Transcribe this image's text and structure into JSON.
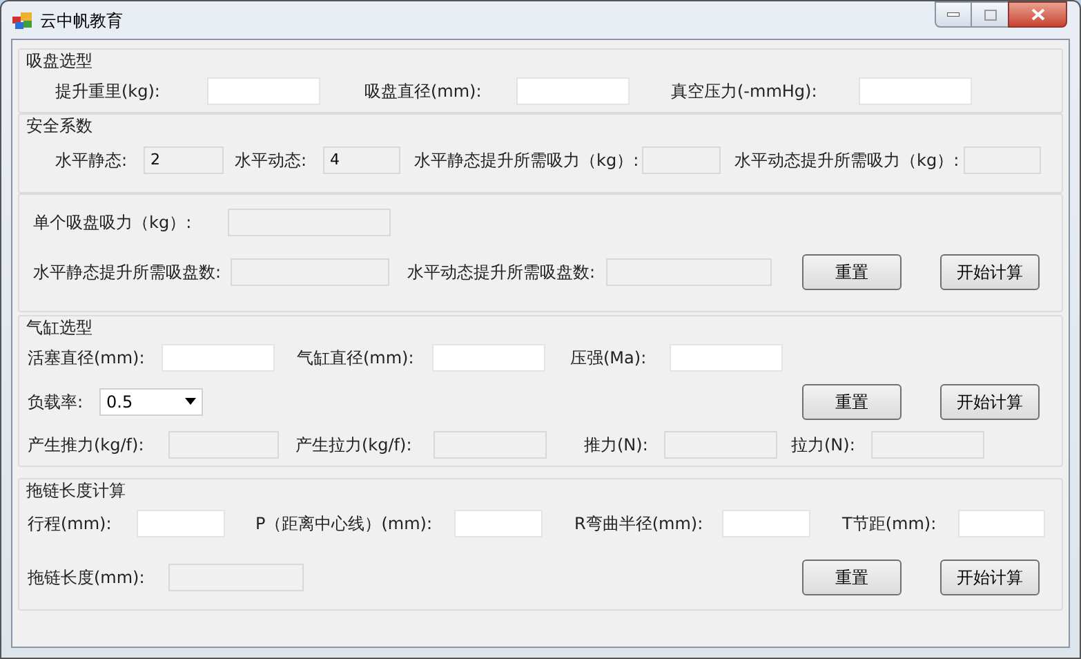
{
  "window": {
    "title": "云中帆教育"
  },
  "sections": [
    {
      "title": "吸盘选型",
      "rows": [
        [
          {
            "kind": "input",
            "label": "提升重里(kg):"
          },
          {
            "kind": "input",
            "label": "吸盘直径(mm):"
          },
          {
            "kind": "input",
            "label": "真空压力(-mmHg):"
          }
        ]
      ]
    },
    {
      "title": "安全系数",
      "rows": [
        [
          {
            "kind": "readonly",
            "label": "水平静态:",
            "value": "2"
          },
          {
            "kind": "readonly",
            "label": "水平动态:",
            "value": "4"
          },
          {
            "kind": "readonly",
            "label": "水平静态提升所需吸力（kg）:"
          },
          {
            "kind": "readonly",
            "label": "水平动态提升所需吸力（kg）:"
          }
        ]
      ]
    },
    {
      "rows": [
        [
          {
            "kind": "readonly",
            "label": "单个吸盘吸力（kg）:"
          }
        ],
        [
          {
            "kind": "readonly",
            "label": "水平静态提升所需吸盘数:"
          },
          {
            "kind": "readonly",
            "label": "水平动态提升所需吸盘数:"
          }
        ]
      ],
      "buttons": [
        "重置",
        "开始计算"
      ]
    },
    {
      "title": "气缸选型",
      "rows": [
        [
          {
            "kind": "input",
            "label": "活塞直径(mm):"
          },
          {
            "kind": "input",
            "label": "气缸直径(mm):"
          },
          {
            "kind": "input",
            "label": "压强(Ma):"
          }
        ],
        [
          {
            "kind": "select",
            "label": "负载率:",
            "value": "0.5"
          }
        ],
        [
          {
            "kind": "readonly",
            "label": "产生推力(kg/f):"
          },
          {
            "kind": "readonly",
            "label": "产生拉力(kg/f):"
          },
          {
            "kind": "readonly",
            "label": "推力(N):"
          },
          {
            "kind": "readonly",
            "label": "拉力(N):"
          }
        ]
      ],
      "buttons": [
        "重置",
        "开始计算"
      ]
    },
    {
      "title": "拖链长度计算",
      "rows": [
        [
          {
            "kind": "input",
            "label": "行程(mm):"
          },
          {
            "kind": "input",
            "label": "P（距离中心线）(mm):"
          },
          {
            "kind": "input",
            "label": "R弯曲半径(mm):"
          },
          {
            "kind": "input",
            "label": "T节距(mm):"
          }
        ],
        [
          {
            "kind": "readonly",
            "label": "拖链长度(mm):"
          }
        ]
      ],
      "buttons": [
        "重置",
        "开始计算"
      ]
    }
  ]
}
